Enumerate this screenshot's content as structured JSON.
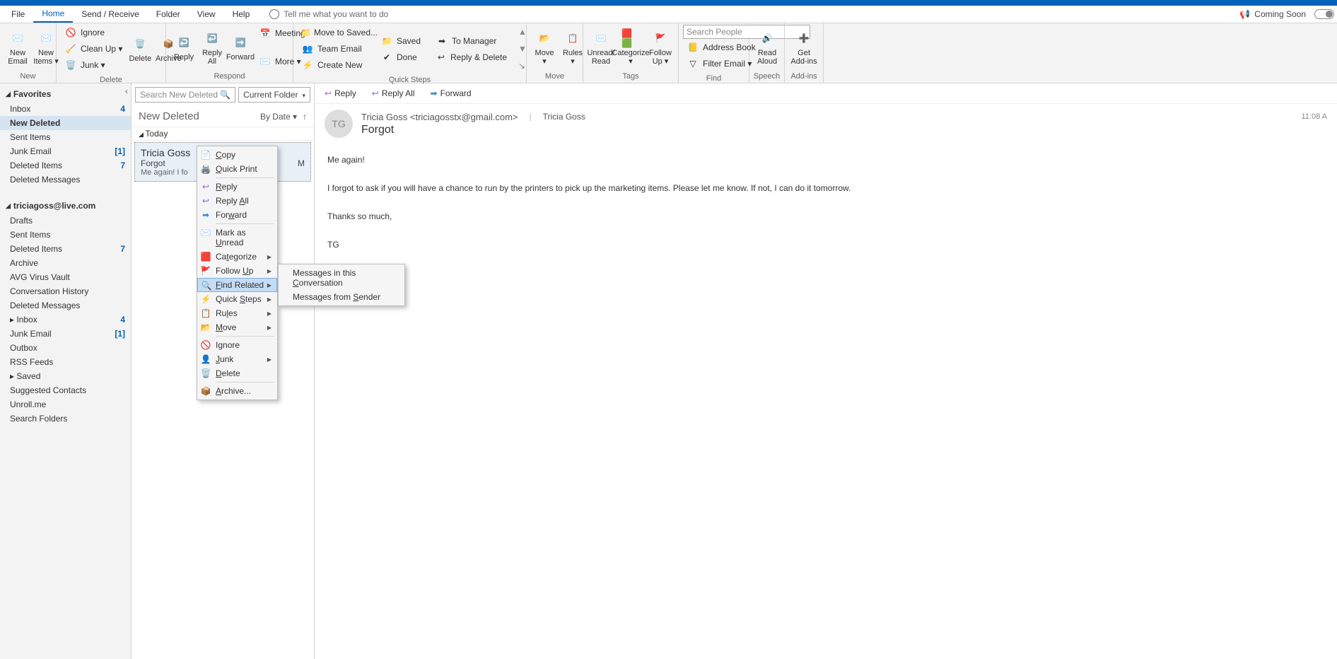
{
  "tabs": {
    "file": "File",
    "home": "Home",
    "send": "Send / Receive",
    "folder": "Folder",
    "view": "View",
    "help": "Help",
    "tell": "Tell me what you want to do",
    "coming": "Coming Soon"
  },
  "ribbon": {
    "new": {
      "email": "New\nEmail",
      "items": "New\nItems ▾",
      "label": "New"
    },
    "del": {
      "ignore": "Ignore",
      "clean": "Clean Up ▾",
      "junk": "Junk ▾",
      "delete": "Delete",
      "archive": "Archive",
      "label": "Delete"
    },
    "resp": {
      "reply": "Reply",
      "replyall": "Reply\nAll",
      "forward": "Forward",
      "meeting": "Meeting",
      "more": "More ▾",
      "label": "Respond"
    },
    "qs": {
      "save": "Move to Saved...",
      "team": "Team Email",
      "create": "Create New",
      "saved": "Saved",
      "done": "Done",
      "tomgr": "To Manager",
      "rd": "Reply & Delete",
      "label": "Quick Steps"
    },
    "move": {
      "move": "Move\n▾",
      "rules": "Rules\n▾",
      "label": "Move"
    },
    "tags": {
      "unread": "Unread/\nRead",
      "cat": "Categorize\n▾",
      "follow": "Follow\nUp ▾",
      "label": "Tags"
    },
    "find": {
      "placeholder": "Search People",
      "ab": "Address Book",
      "filter": "Filter Email ▾",
      "label": "Find"
    },
    "speech": {
      "aloud": "Read\nAloud",
      "label": "Speech"
    },
    "addins": {
      "get": "Get\nAdd-ins",
      "label": "Add-ins"
    }
  },
  "nav": {
    "fav": "Favorites",
    "favItems": [
      {
        "label": "Inbox",
        "count": "4"
      },
      {
        "label": "New Deleted",
        "sel": true
      },
      {
        "label": "Sent Items"
      },
      {
        "label": "Junk Email",
        "count": "[1]"
      },
      {
        "label": "Deleted Items",
        "count": "7"
      },
      {
        "label": "Deleted Messages"
      }
    ],
    "acct": "triciagoss@live.com",
    "acctItems": [
      {
        "label": "Drafts"
      },
      {
        "label": "Sent Items"
      },
      {
        "label": "Deleted Items",
        "count": "7"
      },
      {
        "label": "Archive"
      },
      {
        "label": "AVG Virus Vault"
      },
      {
        "label": "Conversation History"
      },
      {
        "label": "Deleted Messages"
      },
      {
        "label": "Inbox",
        "count": "4",
        "exp": true
      },
      {
        "label": "Junk Email",
        "count": "[1]"
      },
      {
        "label": "Outbox"
      },
      {
        "label": "RSS Feeds"
      },
      {
        "label": "Saved",
        "exp": true
      },
      {
        "label": "Suggested Contacts"
      },
      {
        "label": "Unroll.me"
      },
      {
        "label": "Search Folders"
      }
    ]
  },
  "list": {
    "searchPlaceholder": "Search New Deleted",
    "scope": "Current Folder",
    "title": "New Deleted",
    "sort": "By Date ▾",
    "group": "Today",
    "msg": {
      "from": "Tricia Goss",
      "subj": "Forgot",
      "time": "M",
      "preview": "Me again!  I fo"
    }
  },
  "read": {
    "actions": {
      "reply": "Reply",
      "replyall": "Reply All",
      "forward": "Forward"
    },
    "fromLine": "Tricia Goss <triciagosstx@gmail.com>",
    "toName": "Tricia Goss",
    "subject": "Forgot",
    "time": "11:08 A",
    "avatar": "TG",
    "body": {
      "p1": "Me again!",
      "p2": "I forgot to ask if you will have a chance to run by the printers to pick up the marketing items. Please let me know. If not, I can do it tomorrow.",
      "p3": "Thanks so much,",
      "p4": "TG"
    }
  },
  "ctx": {
    "copy": "Copy",
    "qp": "Quick Print",
    "reply": "Reply",
    "replyall": "Reply All",
    "forward": "Forward",
    "unread": "Mark as Unread",
    "cat": "Categorize",
    "follow": "Follow Up",
    "find": "Find Related",
    "qs": "Quick Steps",
    "rules": "Rules",
    "move": "Move",
    "ignore": "Ignore",
    "junk": "Junk",
    "delete": "Delete",
    "archive": "Archive..."
  },
  "sub": {
    "conv": "Messages in this Conversation",
    "sender": "Messages from Sender"
  }
}
